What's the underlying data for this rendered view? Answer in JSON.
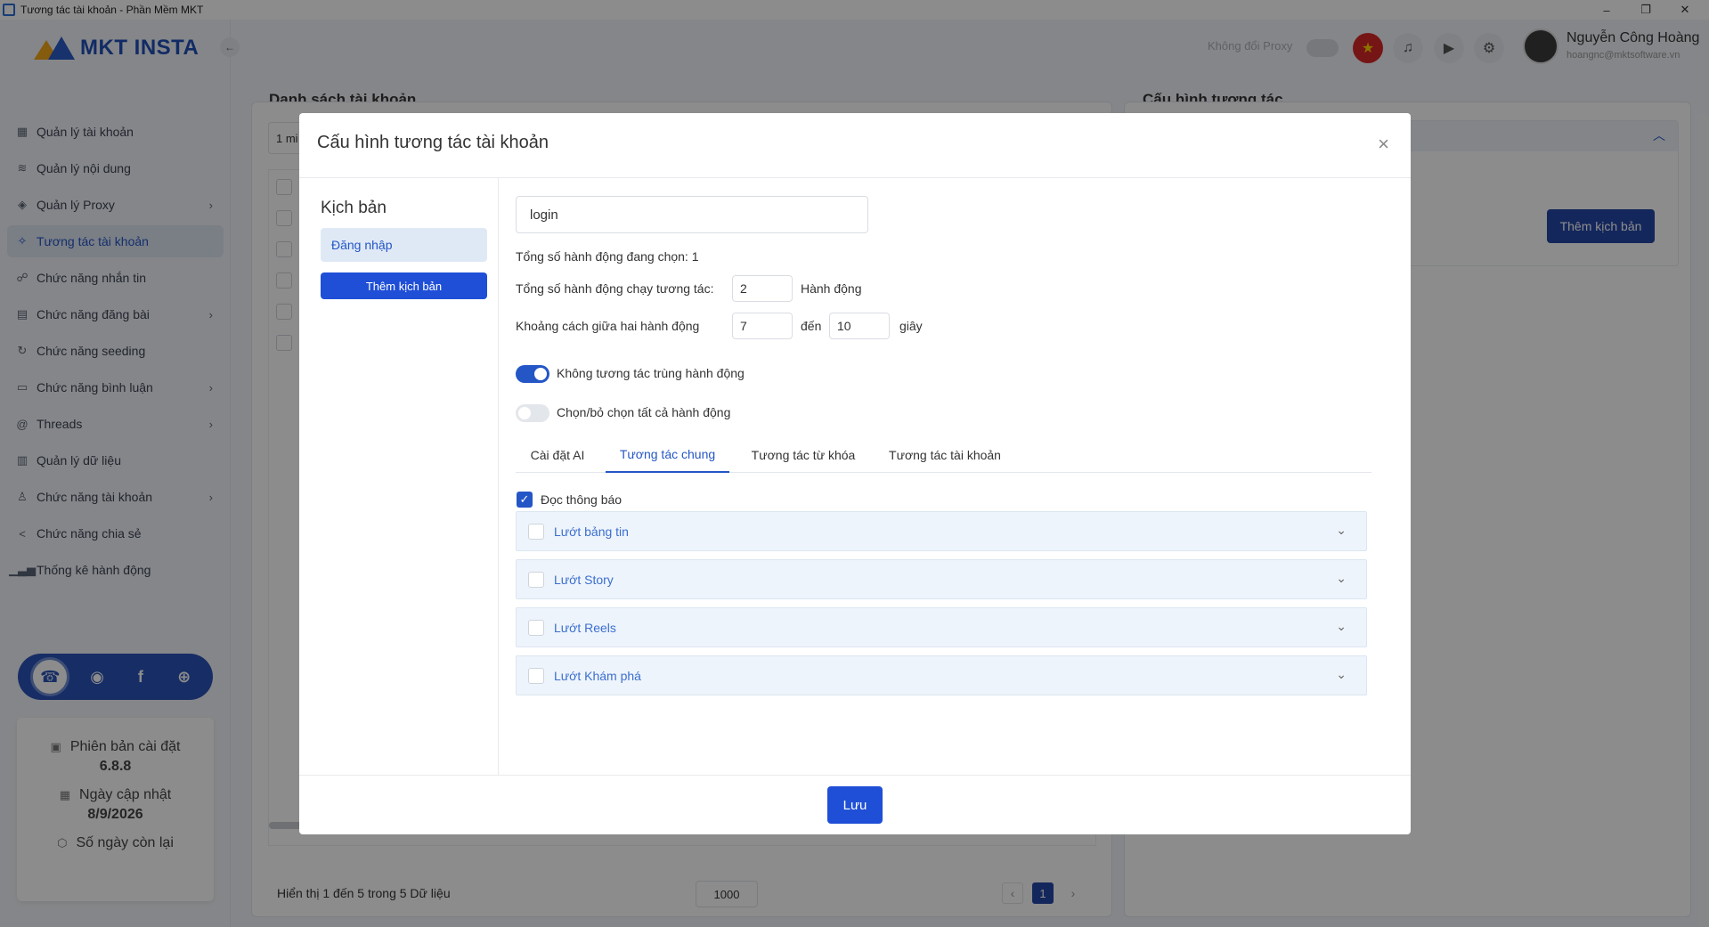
{
  "window": {
    "title": "Tương tác tài khoản - Phần Mềm MKT",
    "minimize": "–",
    "restore": "❐",
    "close": "✕"
  },
  "sidebar": {
    "logo_text": "MKT INSTA",
    "collapse_icon": "arrow-left-icon",
    "items": [
      {
        "label": "Quản lý tài khoản",
        "icon": "grid-icon",
        "has_children": false
      },
      {
        "label": "Quản lý nội dung",
        "icon": "content-icon",
        "has_children": false
      },
      {
        "label": "Quản lý Proxy",
        "icon": "layers-icon",
        "has_children": true
      },
      {
        "label": "Tương tác tài khoản",
        "icon": "interaction-icon",
        "has_children": false,
        "active": true
      },
      {
        "label": "Chức năng nhắn tin",
        "icon": "message-icon",
        "has_children": false
      },
      {
        "label": "Chức năng đăng bài",
        "icon": "post-icon",
        "has_children": true
      },
      {
        "label": "Chức năng seeding",
        "icon": "seeding-icon",
        "has_children": false
      },
      {
        "label": "Chức năng bình luận",
        "icon": "comment-icon",
        "has_children": true
      },
      {
        "label": "Threads",
        "icon": "threads-icon",
        "has_children": true
      },
      {
        "label": "Quản lý dữ liệu",
        "icon": "data-icon",
        "has_children": false
      },
      {
        "label": "Chức năng tài khoản",
        "icon": "user-icon",
        "has_children": true
      },
      {
        "label": "Chức năng chia sẻ",
        "icon": "share-icon",
        "has_children": false
      },
      {
        "label": "Thống kê hành động",
        "icon": "chart-icon",
        "has_children": false
      }
    ],
    "social": [
      "support-icon",
      "zalo-icon",
      "facebook-icon",
      "website-icon"
    ],
    "version_card": {
      "version_label": "Phiên bản cài đặt",
      "version_value": "6.8.8",
      "update_label": "Ngày cập nhật",
      "update_value": "8/9/2026",
      "days_left_label": "Số ngày còn lại"
    }
  },
  "header": {
    "proxy_label": "Không đổi Proxy",
    "user_name": "Nguyễn Công Hoàng",
    "user_email": "hoangnc@mktsoftware.vn"
  },
  "background": {
    "accounts_title": "Danh sách tài khoản",
    "filter_text": "1 mi",
    "config_title": "Cấu hình tương tác",
    "add_script_button": "Thêm kịch bản",
    "pagination_info": "Hiển thị 1 đến 5 trong 5 Dữ liệu",
    "page_size": "1000",
    "current_page": "1",
    "prev": "‹",
    "next": "›"
  },
  "modal": {
    "title": "Cấu hình tương tác tài khoản",
    "close_icon": "×",
    "scripts_title": "Kịch bản",
    "script_items": [
      "Đăng nhập"
    ],
    "add_script_button": "Thêm kịch bản",
    "script_name": "login",
    "selected_count_label": "Tổng số hành động đang chọn: 1",
    "run_count_label": "Tổng số hành động chạy tương tác:",
    "run_count_value": "2",
    "run_count_unit": "Hành động",
    "interval_label": "Khoảng cách giữa hai hành động",
    "interval_from": "7",
    "interval_to_word": "đến",
    "interval_to": "10",
    "interval_unit": "giây",
    "no_duplicate_label": "Không tương tác trùng hành động",
    "no_duplicate_on": true,
    "select_all_label": "Chọn/bỏ chọn tất cả hành động",
    "select_all_on": false,
    "tabs": [
      "Cài đặt AI",
      "Tương tác chung",
      "Tương tác từ khóa",
      "Tương tác tài khoản"
    ],
    "active_tab": "Tương tác chung",
    "read_notifications_label": "Đọc thông báo",
    "read_notifications_checked": true,
    "accordions": [
      "Lướt bảng tin",
      "Lướt Story",
      "Lướt Reels",
      "Lướt Khám phá"
    ],
    "save_button": "Lưu"
  },
  "colors": {
    "primary": "#1f4fd6",
    "active_bg": "#dfe6f3",
    "overlay": "rgba(0,0,0,0.45)"
  }
}
